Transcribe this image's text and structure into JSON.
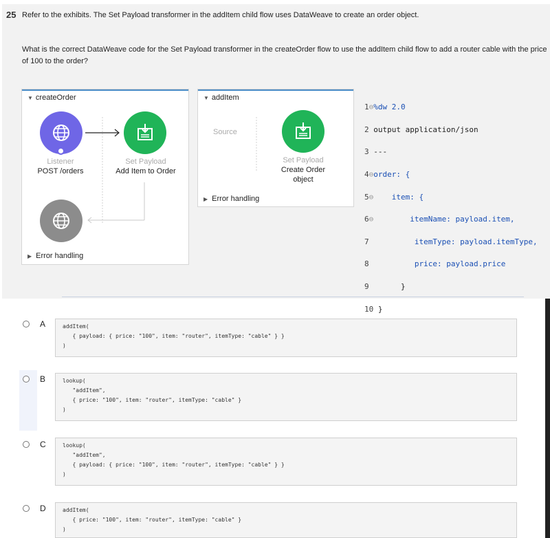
{
  "question": {
    "number": "25",
    "intro": "Refer to the exhibits. The Set Payload transformer in the addItem child flow uses DataWeave to create an order object.",
    "text": "What is the correct DataWeave code for the Set Payload transformer in the createOrder flow to use the addItem child flow to add a router cable with the price of 100 to the order?"
  },
  "create_order_flow": {
    "title": "createOrder",
    "listener": {
      "type": "Listener",
      "name": "POST /orders",
      "icon": "globe-icon"
    },
    "set_payload": {
      "type": "Set Payload",
      "name": "Add Item to Order",
      "icon": "set-payload-icon"
    },
    "error_handling": "Error handling"
  },
  "add_item_flow": {
    "title": "addItem",
    "source": "Source",
    "set_payload": {
      "type": "Set Payload",
      "name_line1": "Create Order",
      "name_line2": "object"
    },
    "error_handling": "Error handling"
  },
  "code": {
    "lines": [
      {
        "n": "1",
        "text": "%dw 2.0"
      },
      {
        "n": "2",
        "text": "output application/json"
      },
      {
        "n": "3",
        "text": "---"
      },
      {
        "n": "4",
        "text": "order: {"
      },
      {
        "n": "5",
        "text": "item: {"
      },
      {
        "n": "6",
        "text": "itemName: payload.item,"
      },
      {
        "n": "7",
        "text": "itemType: payload.itemType,"
      },
      {
        "n": "8",
        "text": "price: payload.price"
      },
      {
        "n": "9",
        "text": "}"
      },
      {
        "n": "10",
        "text": "}"
      }
    ]
  },
  "options": [
    {
      "letter": "A",
      "code": "addItem(\n   { payload: { price: \"100\", item: \"router\", itemType: \"cable\" } }\n)"
    },
    {
      "letter": "B",
      "code": "lookup(\n   \"addItem\",\n   { price: \"100\", item: \"router\", itemType: \"cable\" }\n)"
    },
    {
      "letter": "C",
      "code": "lookup(\n   \"addItem\",\n   { payload: { price: \"100\", item: \"router\", itemType: \"cable\" } }\n)"
    },
    {
      "letter": "D",
      "code": "addItem(\n   { price: \"100\", item: \"router\", itemType: \"cable\" }\n)"
    }
  ],
  "colors": {
    "accent_blue": "#4a8cc7",
    "listener_purple": "#6f66e6",
    "payload_green": "#20b458",
    "flowref_gray": "#8c8c8c"
  }
}
